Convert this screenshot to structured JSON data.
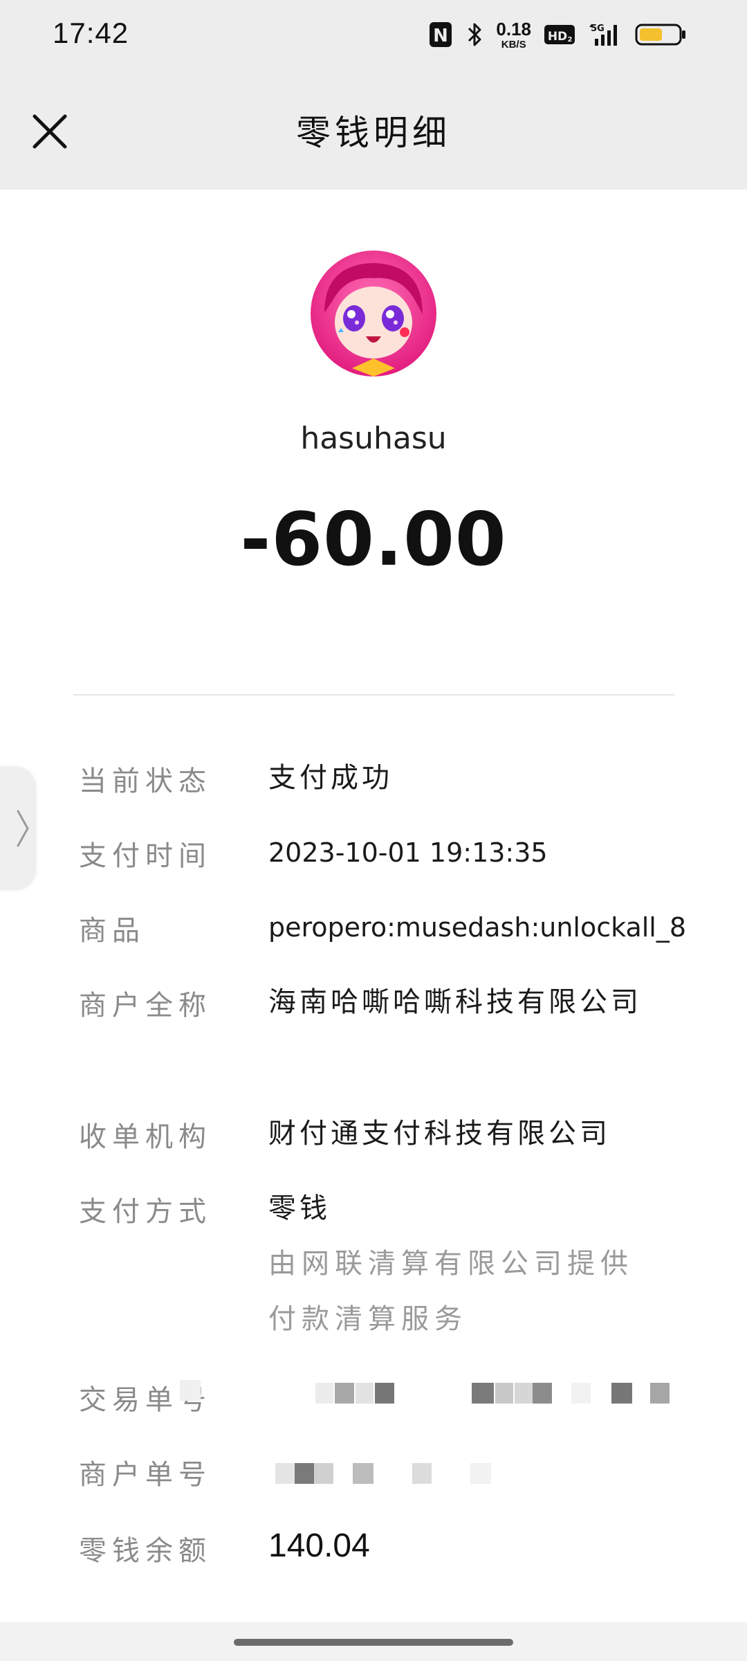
{
  "status_bar": {
    "time": "17:42",
    "nfc_label": "N",
    "net_speed_value": "0.18",
    "net_speed_unit": "KB/S",
    "hd_label": "HD",
    "network_label": "5G",
    "battery_level": 0.6,
    "battery_color": "#f5c02e"
  },
  "header": {
    "title": "零钱明细",
    "close_icon": "close-icon"
  },
  "payee": {
    "name": "hasuhasu",
    "amount": "-60.00"
  },
  "details": {
    "status_label": "当前状态",
    "status_value": "支付成功",
    "time_label": "支付时间",
    "time_value": "2023-10-01 19:13:35",
    "product_label": "商品",
    "product_value": "peropero:musedash:unlockall_8",
    "merchant_label": "商户全称",
    "merchant_value": "海南哈嘶哈嘶科技有限公司",
    "acquirer_label": "收单机构",
    "acquirer_value": "财付通支付科技有限公司",
    "method_label": "支付方式",
    "method_value": "零钱",
    "method_note": "由网联清算有限公司提供付款清算服务",
    "txn_label": "交易单号",
    "merchant_order_label": "商户单号",
    "balance_label": "零钱余额",
    "balance_value": "140.04"
  },
  "colors": {
    "top_bg": "#ededed",
    "label_gray": "#8a8a8a",
    "text_dark": "#111111"
  }
}
